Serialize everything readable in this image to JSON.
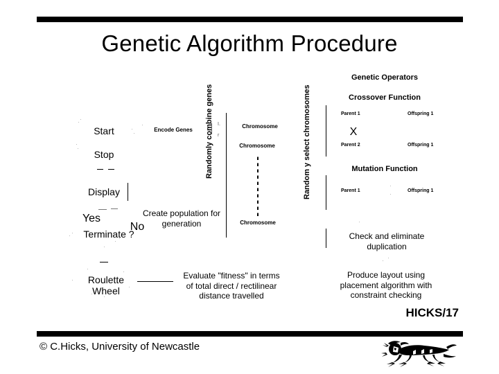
{
  "slide": {
    "title": "Genetic Algorithm Procedure",
    "page_ref": "HICKS/17",
    "copyright": "© C.Hicks, University of Newcastle",
    "crest_icon": "heraldic-lion-icon"
  },
  "flow": {
    "start": "Start",
    "stop": "Stop",
    "display": "Display",
    "yes": "Yes",
    "no": "No",
    "terminate": "Terminate ?",
    "roulette_wheel": "Roulette\nWheel",
    "encode_genes": "Encode Genes",
    "create_population": "Create population for\ngeneration",
    "evaluate_fitness": "Evaluate \"fitness\" in terms\nof total direct / rectilinear\ndistance travelled"
  },
  "columns": {
    "randomly_combine_genes": "Randomly combine genes",
    "randomly_select_chromosomes": "Random y select chromosomes"
  },
  "chromosomes": {
    "label_1": "Chromosome",
    "label_2": "Chromosome",
    "label_3": "Chromosome"
  },
  "operators": {
    "heading": "Genetic Operators",
    "crossover": {
      "title": "Crossover Function",
      "parent_1": "Parent 1",
      "parent_2": "Parent 2",
      "offspring_1": "Offspring 1",
      "offspring_2": "Offspring 1",
      "cross_mark": "X"
    },
    "mutation": {
      "title": "Mutation Function",
      "parent_1": "Parent 1",
      "offspring_1": "Offspring 1"
    },
    "check_duplication": "Check and eliminate\nduplication",
    "produce_layout": "Produce layout using\nplacement algorithm with\nconstraint checking"
  },
  "colors": {
    "ink": "#000000",
    "page": "#ffffff"
  }
}
